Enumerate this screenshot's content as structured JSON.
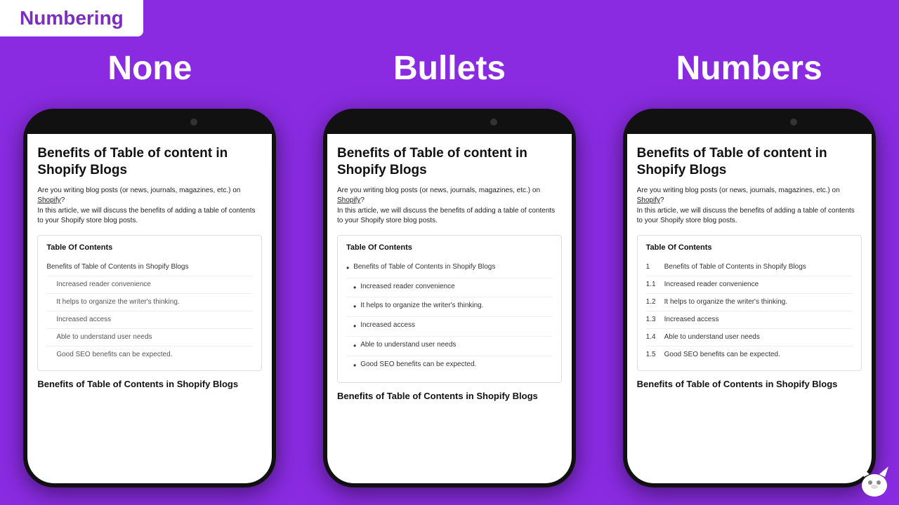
{
  "header": {
    "badge_label": "Numbering"
  },
  "columns": [
    {
      "label": "None"
    },
    {
      "label": "Bullets"
    },
    {
      "label": "Numbers"
    }
  ],
  "phone_none": {
    "blog_title": "Benefits of Table of content in Shopify Blogs",
    "intro_line1": "Are you writing blog posts (or news, journals, magazines, etc.) on ",
    "shopify_link": "Shopify",
    "intro_line2": "?",
    "intro_line3": "In this article, we will discuss the benefits of adding a table of contents to your Shopify store blog posts.",
    "toc_title": "Table Of Contents",
    "toc_items": [
      {
        "type": "main",
        "text": "Benefits of Table of Contents in Shopify Blogs"
      },
      {
        "type": "sub",
        "text": "Increased reader convenience"
      },
      {
        "type": "sub",
        "text": "It helps to organize the writer's thinking."
      },
      {
        "type": "sub",
        "text": "Increased access"
      },
      {
        "type": "sub",
        "text": "Able to understand user needs"
      },
      {
        "type": "sub",
        "text": "Good SEO benefits can be expected."
      }
    ],
    "bottom_heading": "Benefits of Table of Contents in Shopify Blogs"
  },
  "phone_bullets": {
    "blog_title": "Benefits of Table of content in Shopify Blogs",
    "intro_line1": "Are you writing blog posts (or news, journals, magazines, etc.) on ",
    "shopify_link": "Shopify",
    "intro_line2": "?",
    "intro_line3": "In this article, we will discuss the benefits of adding a table of contents to your Shopify store blog posts.",
    "toc_title": "Table Of Contents",
    "toc_items": [
      {
        "type": "main-bullet",
        "text": "Benefits of Table of Contents in Shopify Blogs"
      },
      {
        "type": "sub-bullet",
        "text": "Increased reader convenience"
      },
      {
        "type": "sub-bullet",
        "text": "It helps to organize the writer's thinking."
      },
      {
        "type": "sub-bullet",
        "text": "Increased access"
      },
      {
        "type": "sub-bullet",
        "text": "Able to understand user needs"
      },
      {
        "type": "sub-bullet",
        "text": "Good SEO benefits can be expected."
      }
    ],
    "bottom_heading": "Benefits of Table of Contents in Shopify Blogs"
  },
  "phone_numbers": {
    "blog_title": "Benefits of Table of content in Shopify Blogs",
    "intro_line1": "Are you writing blog posts (or news, journals, magazines, etc.) on ",
    "shopify_link": "Shopify",
    "intro_line2": "?",
    "intro_line3": "In this article, we will discuss the benefits of adding a table of contents to your Shopify store blog posts.",
    "toc_title": "Table Of Contents",
    "toc_items": [
      {
        "num": "1",
        "text": "Benefits of Table of Contents in Shopify Blogs"
      },
      {
        "num": "1.1",
        "text": "Increased reader convenience"
      },
      {
        "num": "1.2",
        "text": "It helps to organize the writer's thinking."
      },
      {
        "num": "1.3",
        "text": "Increased access"
      },
      {
        "num": "1.4",
        "text": "Able to understand user needs"
      },
      {
        "num": "1.5",
        "text": "Good SEO benefits can be expected."
      }
    ],
    "bottom_heading": "Benefits of Table of Contents in Shopify Blogs"
  }
}
